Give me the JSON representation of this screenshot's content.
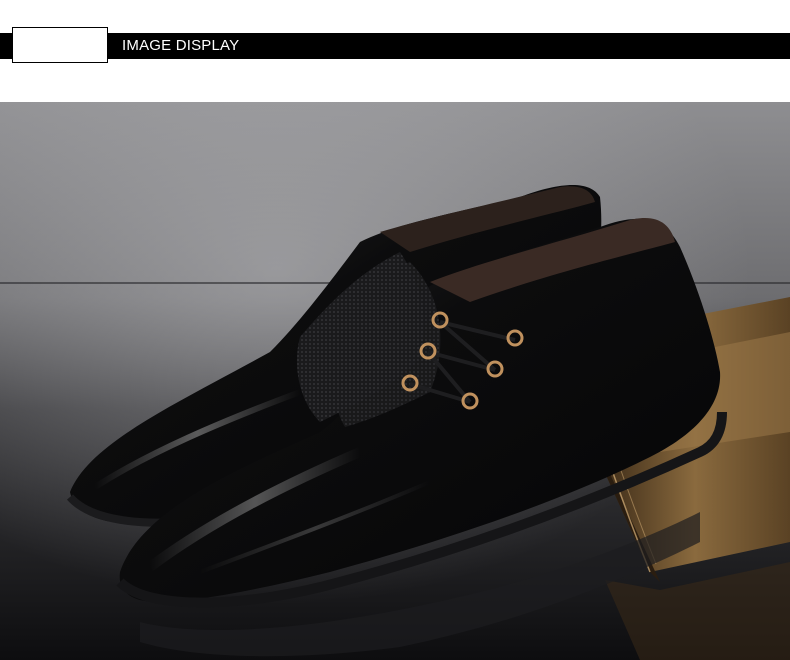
{
  "header": {
    "title": "IMAGE DISPLAY"
  },
  "photo": {
    "subject": "black-leather-dress-shoes",
    "colors": {
      "background_top": "#8d8d90",
      "background_bottom": "#101012",
      "leather": "#0b0b0c",
      "book": "#7a5a32",
      "eyelet": "#b98a5a"
    }
  }
}
